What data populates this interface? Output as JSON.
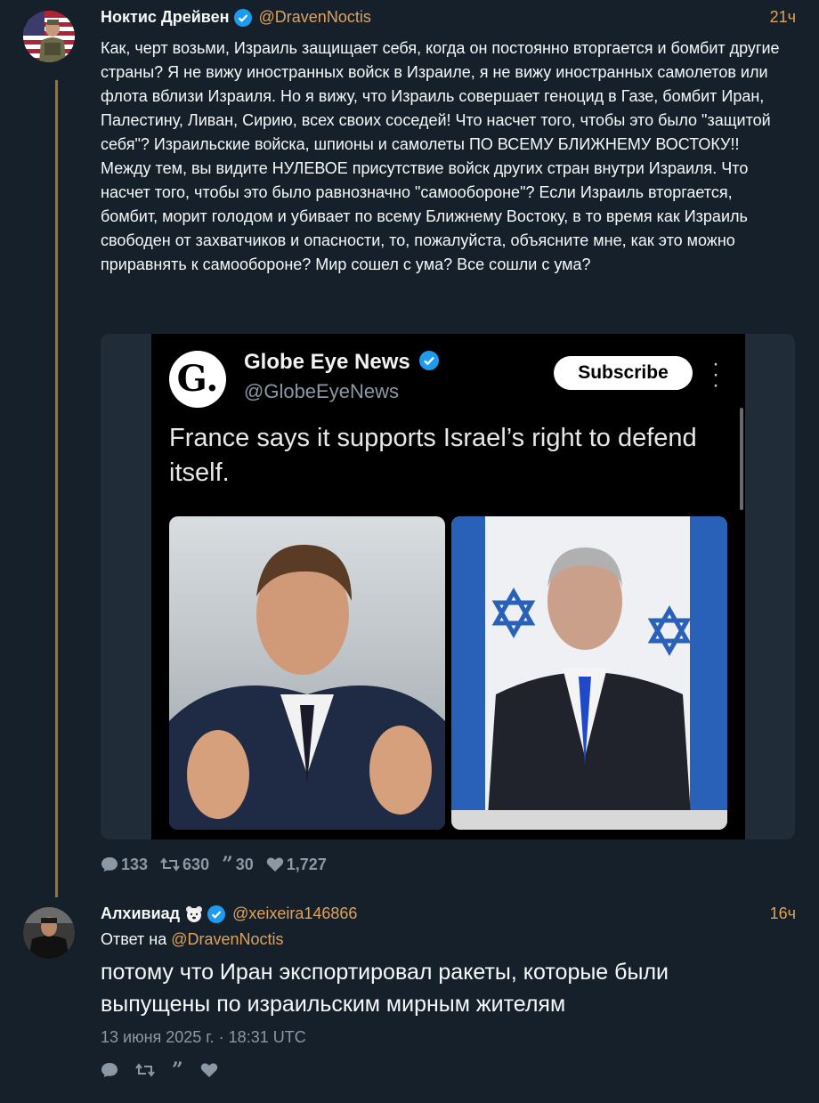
{
  "colors": {
    "background": "#15202b",
    "accent": "#e0a25a",
    "muted": "#8b98a5",
    "verified": "#1d9bf0"
  },
  "post1": {
    "author_name": "Ноктис Дрейвен",
    "handle": "@DravenNoctis",
    "time": "21ч",
    "text": "Как, черт возьми, Израиль защищает себя, когда он постоянно вторгается и бомбит другие страны? Я не вижу иностранных войск в Израиле, я не вижу иностранных самолетов или флота вблизи Израиля. Но я вижу, что Израиль совершает геноцид в Газе, бомбит Иран, Палестину, Ливан, Сирию, всех своих соседей! Что насчет того, чтобы это было \"защитой себя\"? Израильские войска, шпионы и самолеты ПО ВСЕМУ БЛИЖНЕМУ ВОСТОКУ!! Между тем, вы видите НУЛЕВОЕ присутствие войск других стран внутри Израиля. Что насчет того, чтобы это было равнозначно \"самообороне\"? Если Израиль вторгается, бомбит, морит голодом и убивает по всему Ближнему Востоку, в то время как Израиль свободен от захватчиков и опасности, то, пожалуйста, объясните мне, как это можно приравнять к самообороне? Мир сошел с ума? Все сошли с ума?",
    "media": {
      "logo_letter": "G.",
      "source_name": "Globe Eye News",
      "source_handle": "@GlobeEyeNews",
      "subscribe_label": "Subscribe",
      "headline": "France says it supports Israel’s right to defend itself."
    },
    "stats": {
      "replies": "133",
      "reposts": "630",
      "quotes": "30",
      "likes": "1,727"
    }
  },
  "post2": {
    "author_name": "Алхивиад",
    "handle": "@xeixeira146866",
    "time": "16ч",
    "reply_prefix": "Ответ на",
    "reply_handle": "@DravenNoctis",
    "text": "потому что Иран экспортировал ракеты, которые были выпущены по израильским мирным жителям",
    "date": "13 июня 2025 г. · 18:31 UTC"
  }
}
